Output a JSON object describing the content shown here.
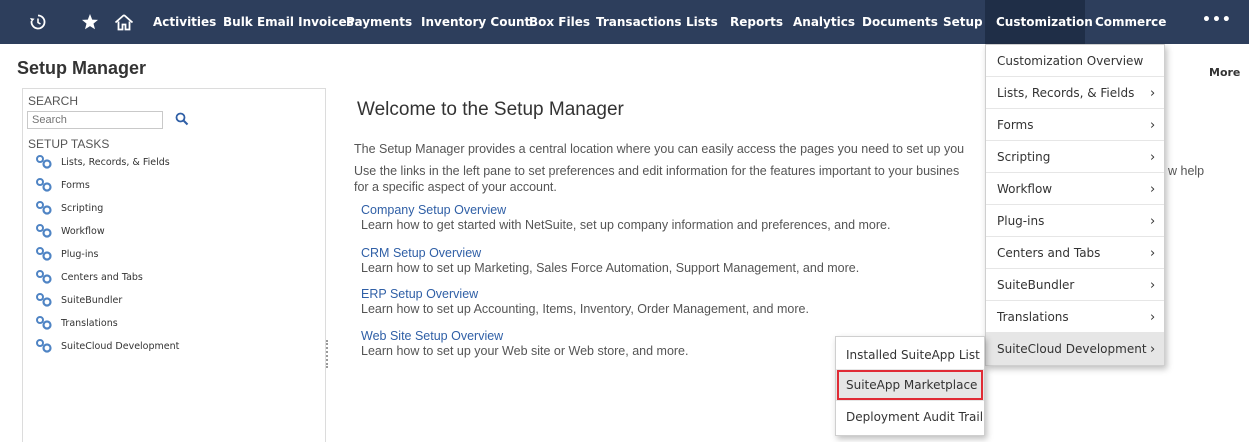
{
  "nav": {
    "icons": [
      "recent-icon",
      "star-icon",
      "home-icon"
    ],
    "items": [
      "Activities",
      "Bulk Email Invoices",
      "Payments",
      "Inventory Count",
      "Box Files",
      "Transactions",
      "Lists",
      "Reports",
      "Analytics",
      "Documents",
      "Setup",
      "Customization",
      "Commerce"
    ],
    "active": "Customization",
    "more": "•••",
    "colors": {
      "bar": "#2d3e5c",
      "active": "#1f2e47"
    }
  },
  "page": {
    "title": "Setup Manager",
    "more": "More"
  },
  "left": {
    "search_heading": "SEARCH",
    "search_placeholder": "Search",
    "tasks_heading": "SETUP TASKS",
    "tasks": [
      "Lists, Records, & Fields",
      "Forms",
      "Scripting",
      "Workflow",
      "Plug-ins",
      "Centers and Tabs",
      "SuiteBundler",
      "Translations",
      "SuiteCloud Development"
    ]
  },
  "main": {
    "welcome": "Welcome to the Setup Manager",
    "intro1": "The Setup Manager provides a central location where you can easily access the pages you need to set up you",
    "intro2a": "Use the links in the left pane to set preferences and edit information for the features important to your busines",
    "intro2b": "w help",
    "intro3": "for a specific aspect of your account.",
    "sections": [
      {
        "link": "Company Setup Overview",
        "desc": "Learn how to get started with NetSuite, set up company information and preferences, and more."
      },
      {
        "link": "CRM Setup Overview",
        "desc": "Learn how to set up Marketing, Sales Force Automation, Support Management, and more."
      },
      {
        "link": "ERP Setup Overview",
        "desc": "Learn how to set up Accounting, Items, Inventory, Order Management, and more."
      },
      {
        "link": "Web Site Setup Overview",
        "desc": "Learn how to set up your Web site or Web store, and more."
      }
    ],
    "link_color": "#2f5fa6"
  },
  "menu": {
    "items": [
      {
        "label": "Customization Overview",
        "arrow": ""
      },
      {
        "label": "Lists, Records, & Fields",
        "arrow": "›"
      },
      {
        "label": "Forms",
        "arrow": "›"
      },
      {
        "label": "Scripting",
        "arrow": "›"
      },
      {
        "label": "Workflow",
        "arrow": "›"
      },
      {
        "label": "Plug-ins",
        "arrow": "›"
      },
      {
        "label": "Centers and Tabs",
        "arrow": "›"
      },
      {
        "label": "SuiteBundler",
        "arrow": "›"
      },
      {
        "label": "Translations",
        "arrow": "›"
      },
      {
        "label": "SuiteCloud Development",
        "arrow": "›"
      }
    ],
    "hovered": "SuiteCloud Development"
  },
  "submenu": {
    "items": [
      "Installed SuiteApp List",
      "SuiteApp Marketplace",
      "Deployment Audit Trail"
    ],
    "highlighted": "SuiteApp Marketplace",
    "highlight_color": "#e02b35"
  }
}
